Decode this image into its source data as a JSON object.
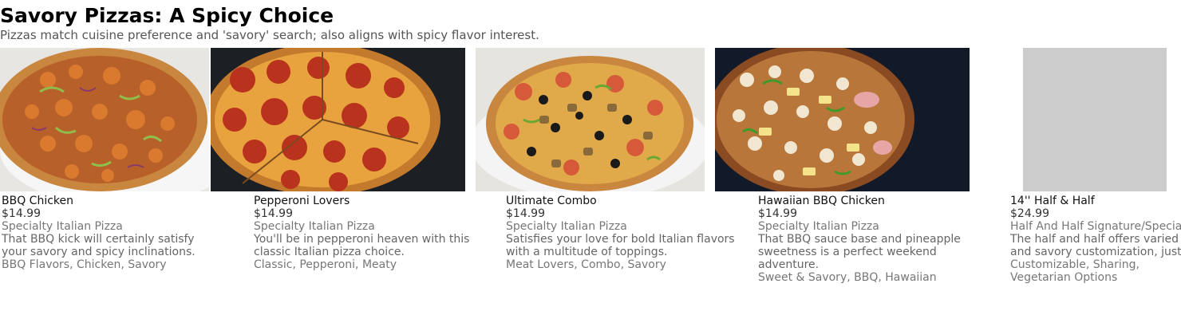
{
  "header": {
    "title": "Savory Pizzas: A Spicy Choice",
    "subtitle": "Pizzas match cuisine preference and 'savory' search; also aligns with spicy flavor interest."
  },
  "colors": {
    "title": "#000000",
    "subtitle": "#555555",
    "placeholder": "#cccccc",
    "dark_backdrop": "#1a1a1a"
  },
  "items": [
    {
      "name": "BBQ Chicken",
      "price": "$14.99",
      "category": "Specialty Italian Pizza",
      "description": "That BBQ kick will certainly satisfy your savory and spicy inclinations.",
      "tags": "BBQ Flavors, Chicken, Savory"
    },
    {
      "name": "Pepperoni Lovers",
      "price": "$14.99",
      "category": "Specialty Italian Pizza",
      "description": "You'll be in pepperoni heaven with this classic Italian pizza choice.",
      "tags": "Classic, Pepperoni, Meaty"
    },
    {
      "name": "Ultimate Combo",
      "price": "$14.99",
      "category": "Specialty Italian Pizza",
      "description": "Satisfies your love for bold Italian flavors with a multitude of toppings.",
      "tags": "Meat Lovers, Combo, Savory"
    },
    {
      "name": "Hawaiian BBQ Chicken",
      "price": "$14.99",
      "category": "Specialty Italian Pizza",
      "description": "That BBQ sauce base and pineapple sweetness is a perfect weekend adventure.",
      "tags": "Sweet & Savory, BBQ, Hawaiian"
    },
    {
      "name": "14'' Half & Half",
      "price": "$24.99",
      "category": "Half And Half Signature/Specialty",
      "description": "The half and half offers varied and savory customization, just",
      "tags": "Customizable, Sharing, Vegetarian Options"
    }
  ]
}
